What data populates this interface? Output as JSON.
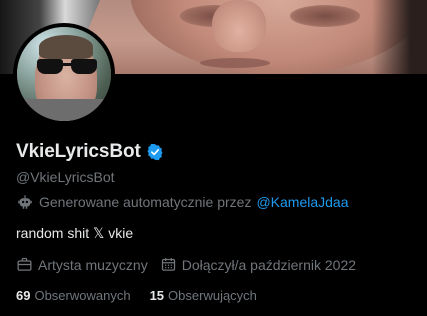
{
  "banner": {
    "description_icon": "banner-image"
  },
  "profile": {
    "display_name": "VkieLyricsBot",
    "verified": true,
    "handle": "@VkieLyricsBot",
    "automated_label": "Generowane automatycznie przez",
    "automated_by": "@KamelaJdaa",
    "bio": "random shit 𝕏 vkie",
    "category": "Artysta muzyczny",
    "joined": "Dołączył/a październik 2022",
    "following_count": "69",
    "following_label": "Obserwowanych",
    "followers_count": "15",
    "followers_label": "Obserwujących"
  },
  "colors": {
    "background": "#000000",
    "text": "#e7e9ea",
    "muted": "#71767b",
    "accent": "#1d9bf0"
  }
}
